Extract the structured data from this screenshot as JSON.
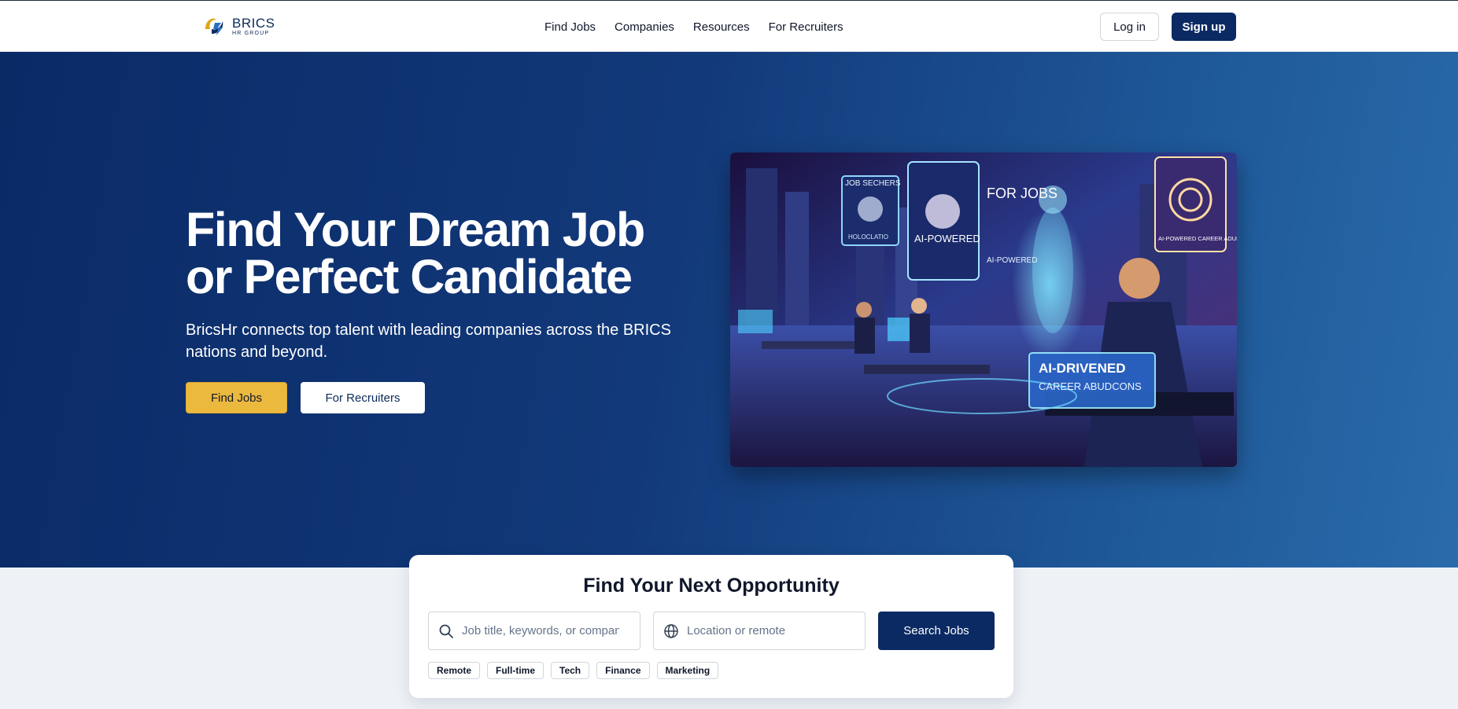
{
  "brand": {
    "name": "BRICS",
    "tagline": "HR GROUP"
  },
  "nav": {
    "items": [
      "Find Jobs",
      "Companies",
      "Resources",
      "For Recruiters"
    ]
  },
  "auth": {
    "login": "Log in",
    "signup": "Sign up"
  },
  "hero": {
    "title_line1": "Find Your Dream Job",
    "title_line2": "or Perfect Candidate",
    "subtitle": "BricsHr connects top talent with leading companies across the BRICS nations and beyond.",
    "primary_cta": "Find Jobs",
    "secondary_cta": "For Recruiters",
    "image_texts": {
      "job_seekers": "JOB SECHERS",
      "ai_powered": "AI-POWERED",
      "for_jobs": "FOR JOBS",
      "ai_powered_small": "AI-POWERED",
      "career_advisor": "AI-POWERED CAREER ADULUGR",
      "ai_driven": "AI-DRIVENED",
      "career_sub": "CAREER ABUDCONS",
      "holo": "HOLOCLATIO"
    }
  },
  "search": {
    "title": "Find Your Next Opportunity",
    "keyword_placeholder": "Job title, keywords, or company",
    "location_placeholder": "Location or remote",
    "button": "Search Jobs",
    "tags": [
      "Remote",
      "Full-time",
      "Tech",
      "Finance",
      "Marketing"
    ]
  },
  "colors": {
    "primary": "#0b2a63",
    "accent": "#ecb93f",
    "hero_start": "#0a2a66",
    "hero_end": "#2a6bab"
  }
}
